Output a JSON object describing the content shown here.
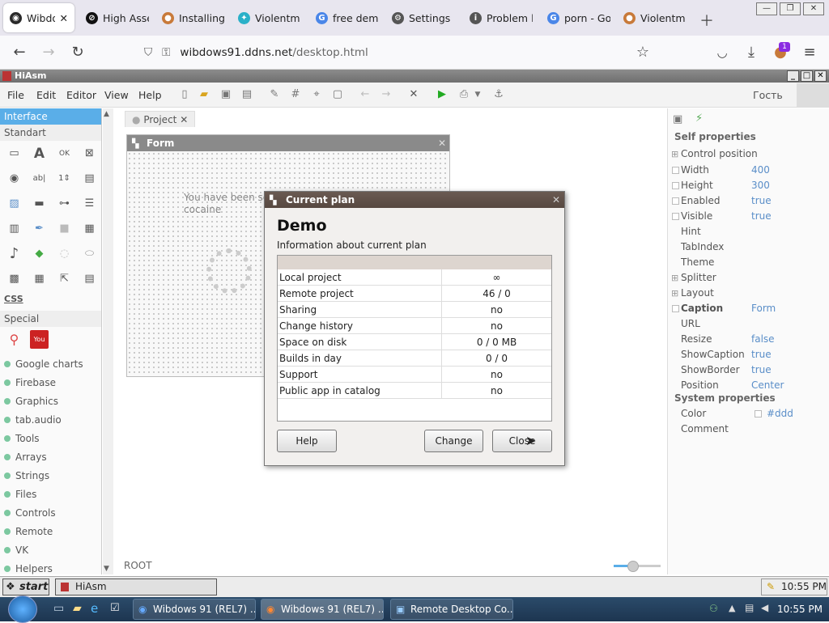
{
  "browser": {
    "tabs": [
      {
        "label": "Wibdo",
        "color": "#2a2a2a",
        "active": true
      },
      {
        "label": "High Asse",
        "color": "#111"
      },
      {
        "label": "Installing",
        "color": "#c87a3a"
      },
      {
        "label": "Violentm",
        "color": "#2ab0c8"
      },
      {
        "label": "free demo",
        "color": "#4a86e8"
      },
      {
        "label": "Settings",
        "color": "#555"
      },
      {
        "label": "Problem l",
        "color": "#555"
      },
      {
        "label": "porn - Go",
        "color": "#4a86e8"
      },
      {
        "label": "Violentm",
        "color": "#c87a3a"
      }
    ],
    "url_host": "wibdows91.ddns.net",
    "url_path": "/desktop.html",
    "badge_count": "1"
  },
  "app": {
    "title": "HiAsm",
    "menu": [
      "File",
      "Edit",
      "Editor",
      "View",
      "Help"
    ],
    "user": "Гость"
  },
  "left": {
    "interface": "Interface",
    "standart": "Standart",
    "css": "CSS",
    "special": "Special",
    "categories": [
      "Google charts",
      "Firebase",
      "Graphics",
      "tab.audio",
      "Tools",
      "Arrays",
      "Strings",
      "Files",
      "Controls",
      "Remote",
      "VK",
      "Helpers"
    ]
  },
  "work": {
    "project_tab": "Project",
    "form_title": "Form",
    "form_text": "You have been sel\ncocaine",
    "status": "ROOT"
  },
  "props": {
    "self": "Self properties",
    "system": "System properties",
    "rows": [
      {
        "name": "Control position",
        "value": ""
      },
      {
        "name": "Width",
        "value": "400"
      },
      {
        "name": "Height",
        "value": "300"
      },
      {
        "name": "Enabled",
        "value": "true"
      },
      {
        "name": "Visible",
        "value": "true"
      },
      {
        "name": "Hint",
        "value": ""
      },
      {
        "name": "TabIndex",
        "value": ""
      },
      {
        "name": "Theme",
        "value": ""
      },
      {
        "name": "Splitter",
        "value": ""
      },
      {
        "name": "Layout",
        "value": ""
      },
      {
        "name": "Caption",
        "value": "Form"
      },
      {
        "name": "URL",
        "value": ""
      },
      {
        "name": "Resize",
        "value": "false"
      },
      {
        "name": "ShowCaption",
        "value": "true"
      },
      {
        "name": "ShowBorder",
        "value": "true"
      },
      {
        "name": "Position",
        "value": "Center"
      }
    ],
    "sys_rows": [
      {
        "name": "Color",
        "value": "#ddd"
      },
      {
        "name": "Comment",
        "value": ""
      }
    ]
  },
  "dialog": {
    "title": "Current plan",
    "heading": "Demo",
    "subtitle": "Information about current plan",
    "rows": [
      {
        "k": "Local project",
        "v": "∞"
      },
      {
        "k": "Remote project",
        "v": "46 / 0"
      },
      {
        "k": "Sharing",
        "v": "no"
      },
      {
        "k": "Change history",
        "v": "no"
      },
      {
        "k": "Space on disk",
        "v": "0 / 0 MB"
      },
      {
        "k": "Builds in day",
        "v": "0 / 0"
      },
      {
        "k": "Support",
        "v": "no"
      },
      {
        "k": "Public app in catalog",
        "v": "no"
      }
    ],
    "help": "Help",
    "change": "Change",
    "close": "Close"
  },
  "xp": {
    "start": "start",
    "item": "HiAsm",
    "time": "10:55 PM"
  },
  "win7": {
    "items": [
      "Wibdows 91 (REL7) ...",
      "Wibdows 91 (REL7) ...",
      "Remote Desktop Co..."
    ],
    "time": "10:55 PM"
  }
}
